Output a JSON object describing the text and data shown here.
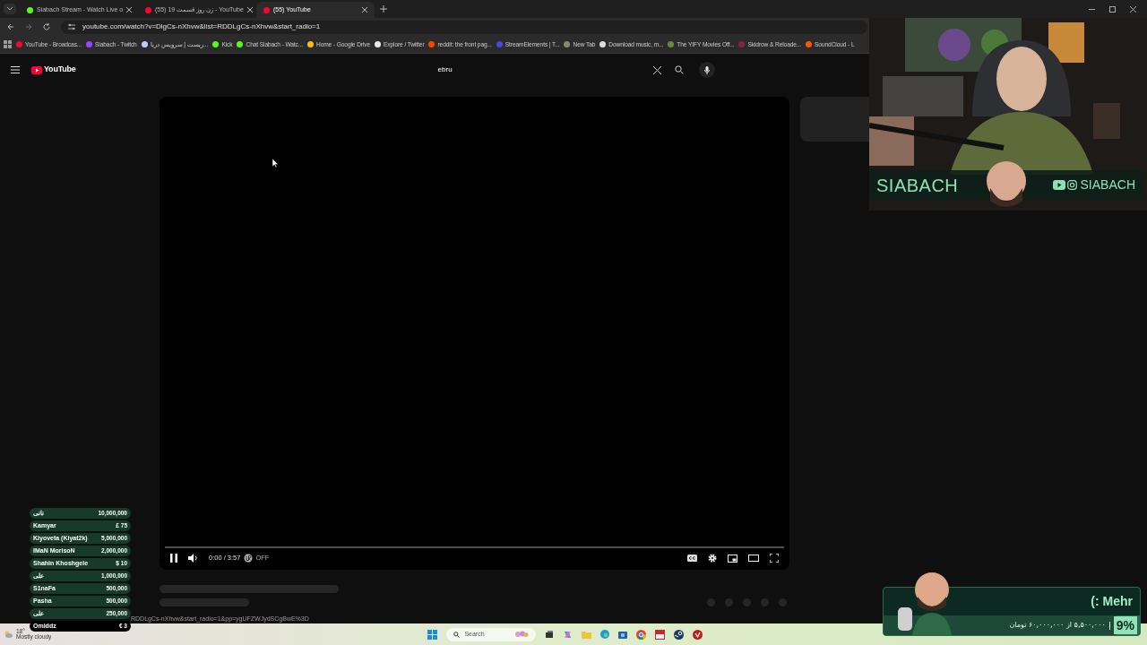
{
  "browser": {
    "tabs": [
      {
        "title": "Siabach Stream - Watch Live o",
        "selected": false,
        "color": "#53fc18"
      },
      {
        "title": "(55) زن روز قسمت 19 - YouTube",
        "selected": false,
        "color": "#ff0033"
      },
      {
        "title": "(55) YouTube",
        "selected": true,
        "color": "#ff0033"
      }
    ],
    "address": "youtube.com/watch?v=DlgCs-nXhvw&list=RDDLgCs-nXhvw&start_radio=1",
    "bookmarks": [
      {
        "label": "YouTube - Broadcas...",
        "color": "#ff0033"
      },
      {
        "label": "Siabach - Twitch",
        "color": "#9146ff"
      },
      {
        "label": "ریست | سرویس دریا...",
        "color": "#c7c7ff"
      },
      {
        "label": "Kick",
        "color": "#53fc18"
      },
      {
        "label": "Chat Siabach - Watc...",
        "color": "#53fc18"
      },
      {
        "label": "Home - Google Drive",
        "color": "#fbbc04"
      },
      {
        "label": "Explore / Twitter",
        "color": "#e8e8e8"
      },
      {
        "label": "reddit: the front pag...",
        "color": "#ff4500"
      },
      {
        "label": "StreamElements | T...",
        "color": "#4f45e4"
      },
      {
        "label": "New Tab",
        "color": "#8a8a6a"
      },
      {
        "label": "Download music, m...",
        "color": "#dddddd"
      },
      {
        "label": "The YIFY Movies Off...",
        "color": "#6a8a3a"
      },
      {
        "label": "Skidrow & Reloade...",
        "color": "#8a2040"
      },
      {
        "label": "SoundCloud - L",
        "color": "#ff5500"
      }
    ]
  },
  "youtube": {
    "logo": "YouTube",
    "search": {
      "value": "ebru"
    },
    "player": {
      "time": "0:00 / 3:57",
      "ambient": "OFF"
    }
  },
  "status_url": "RDDLgCs-nXhvw&start_radio=1&pp=ygUFZWJydSCgBwE%3D",
  "webcam": {
    "kind": "picture",
    "brand": "SIABACH",
    "handle": "SIABACH"
  },
  "donations": [
    {
      "name": "نانی",
      "amount": "10,000,000",
      "highlighted": false
    },
    {
      "name": "Kamyar",
      "amount": "£ 75",
      "highlighted": false
    },
    {
      "name": "Kiyoveta (Kiyat2k)",
      "amount": "5,000,000",
      "highlighted": false
    },
    {
      "name": "IMaN MorisoN",
      "amount": "2,000,000",
      "highlighted": false
    },
    {
      "name": "Shahin Khoshgele",
      "amount": "$ 10",
      "highlighted": false
    },
    {
      "name": "علی",
      "amount": "1,000,000",
      "highlighted": false
    },
    {
      "name": "S1naFa",
      "amount": "500,000",
      "highlighted": false
    },
    {
      "name": "Pasha",
      "amount": "500,000",
      "highlighted": false
    },
    {
      "name": "علی",
      "amount": "250,000",
      "highlighted": false
    },
    {
      "name": "Omiddz",
      "amount": "€ 3",
      "highlighted": true
    }
  ],
  "goal": {
    "title": "(: Mehr",
    "progress": "۵,۵۰۰,۰۰۰ از ۶۰,۰۰۰,۰۰۰ تومان",
    "percent": "9%",
    "level": 0.09
  },
  "taskbar": {
    "weather": {
      "temp": "18°",
      "condition": "Mostly cloudy"
    },
    "search_placeholder": "Search"
  }
}
